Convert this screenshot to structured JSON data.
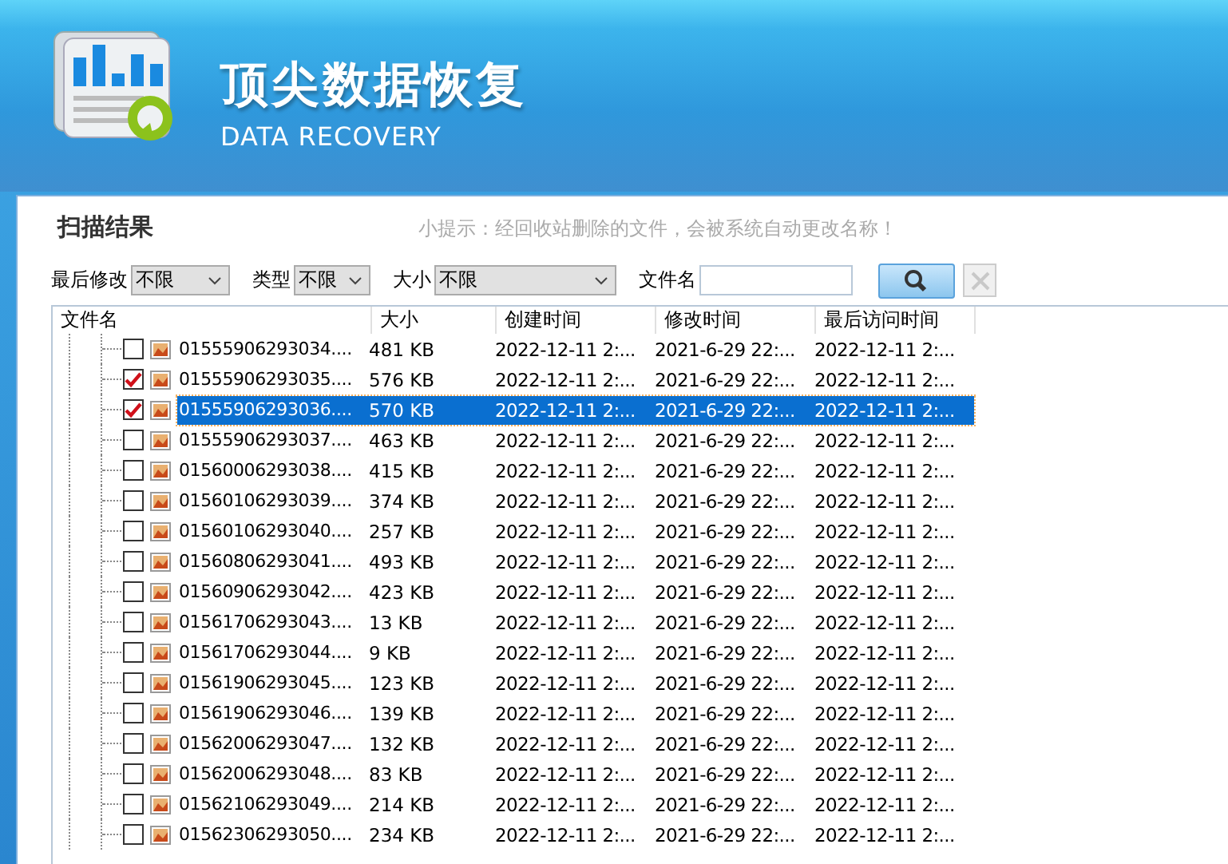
{
  "header": {
    "title": "顶尖数据恢复",
    "subtitle": "DATA RECOVERY"
  },
  "panel": {
    "title": "扫描结果",
    "hint": "小提示：经回收站删除的文件，会被系统自动更改名称！"
  },
  "filters": [
    {
      "kind": "select",
      "label": "最后修改",
      "value": "不限"
    },
    {
      "kind": "select",
      "label": "类型",
      "value": "不限"
    },
    {
      "kind": "select",
      "label": "大小",
      "value": "不限"
    },
    {
      "kind": "text",
      "label": "文件名"
    }
  ],
  "clear_button": {
    "disabled": true
  },
  "table": {
    "columns": [
      "文件名",
      "大小",
      "创建时间",
      "修改时间",
      "最后访问时间"
    ],
    "rows": [
      {
        "name": "01555906293034....",
        "size": "481 KB",
        "created": "2022-12-11 2:...",
        "modified": "2021-6-29 22:...",
        "accessed": "2022-12-11 2:...",
        "checked": false,
        "selected": false
      },
      {
        "name": "01555906293035....",
        "size": "576 KB",
        "created": "2022-12-11 2:...",
        "modified": "2021-6-29 22:...",
        "accessed": "2022-12-11 2:...",
        "checked": true,
        "selected": false
      },
      {
        "name": "01555906293036....",
        "size": "570 KB",
        "created": "2022-12-11 2:...",
        "modified": "2021-6-29 22:...",
        "accessed": "2022-12-11 2:...",
        "checked": true,
        "selected": true
      },
      {
        "name": "01555906293037....",
        "size": "463 KB",
        "created": "2022-12-11 2:...",
        "modified": "2021-6-29 22:...",
        "accessed": "2022-12-11 2:...",
        "checked": false,
        "selected": false
      },
      {
        "name": "01560006293038....",
        "size": "415 KB",
        "created": "2022-12-11 2:...",
        "modified": "2021-6-29 22:...",
        "accessed": "2022-12-11 2:...",
        "checked": false,
        "selected": false
      },
      {
        "name": "01560106293039....",
        "size": "374 KB",
        "created": "2022-12-11 2:...",
        "modified": "2021-6-29 22:...",
        "accessed": "2022-12-11 2:...",
        "checked": false,
        "selected": false
      },
      {
        "name": "01560106293040....",
        "size": "257 KB",
        "created": "2022-12-11 2:...",
        "modified": "2021-6-29 22:...",
        "accessed": "2022-12-11 2:...",
        "checked": false,
        "selected": false
      },
      {
        "name": "01560806293041....",
        "size": "493 KB",
        "created": "2022-12-11 2:...",
        "modified": "2021-6-29 22:...",
        "accessed": "2022-12-11 2:...",
        "checked": false,
        "selected": false
      },
      {
        "name": "01560906293042....",
        "size": "423 KB",
        "created": "2022-12-11 2:...",
        "modified": "2021-6-29 22:...",
        "accessed": "2022-12-11 2:...",
        "checked": false,
        "selected": false
      },
      {
        "name": "01561706293043....",
        "size": "13 KB",
        "created": "2022-12-11 2:...",
        "modified": "2021-6-29 22:...",
        "accessed": "2022-12-11 2:...",
        "checked": false,
        "selected": false
      },
      {
        "name": "01561706293044....",
        "size": "9 KB",
        "created": "2022-12-11 2:...",
        "modified": "2021-6-29 22:...",
        "accessed": "2022-12-11 2:...",
        "checked": false,
        "selected": false
      },
      {
        "name": "01561906293045....",
        "size": "123 KB",
        "created": "2022-12-11 2:...",
        "modified": "2021-6-29 22:...",
        "accessed": "2022-12-11 2:...",
        "checked": false,
        "selected": false
      },
      {
        "name": "01561906293046....",
        "size": "139 KB",
        "created": "2022-12-11 2:...",
        "modified": "2021-6-29 22:...",
        "accessed": "2022-12-11 2:...",
        "checked": false,
        "selected": false
      },
      {
        "name": "01562006293047....",
        "size": "132 KB",
        "created": "2022-12-11 2:...",
        "modified": "2021-6-29 22:...",
        "accessed": "2022-12-11 2:...",
        "checked": false,
        "selected": false
      },
      {
        "name": "01562006293048....",
        "size": "83 KB",
        "created": "2022-12-11 2:...",
        "modified": "2021-6-29 22:...",
        "accessed": "2022-12-11 2:...",
        "checked": false,
        "selected": false
      },
      {
        "name": "01562106293049....",
        "size": "214 KB",
        "created": "2022-12-11 2:...",
        "modified": "2021-6-29 22:...",
        "accessed": "2022-12-11 2:...",
        "checked": false,
        "selected": false
      },
      {
        "name": "01562306293050....",
        "size": "234 KB",
        "created": "2022-12-11 2:...",
        "modified": "2021-6-29 22:...",
        "accessed": "2022-12-11 2:...",
        "checked": false,
        "selected": false
      }
    ]
  }
}
